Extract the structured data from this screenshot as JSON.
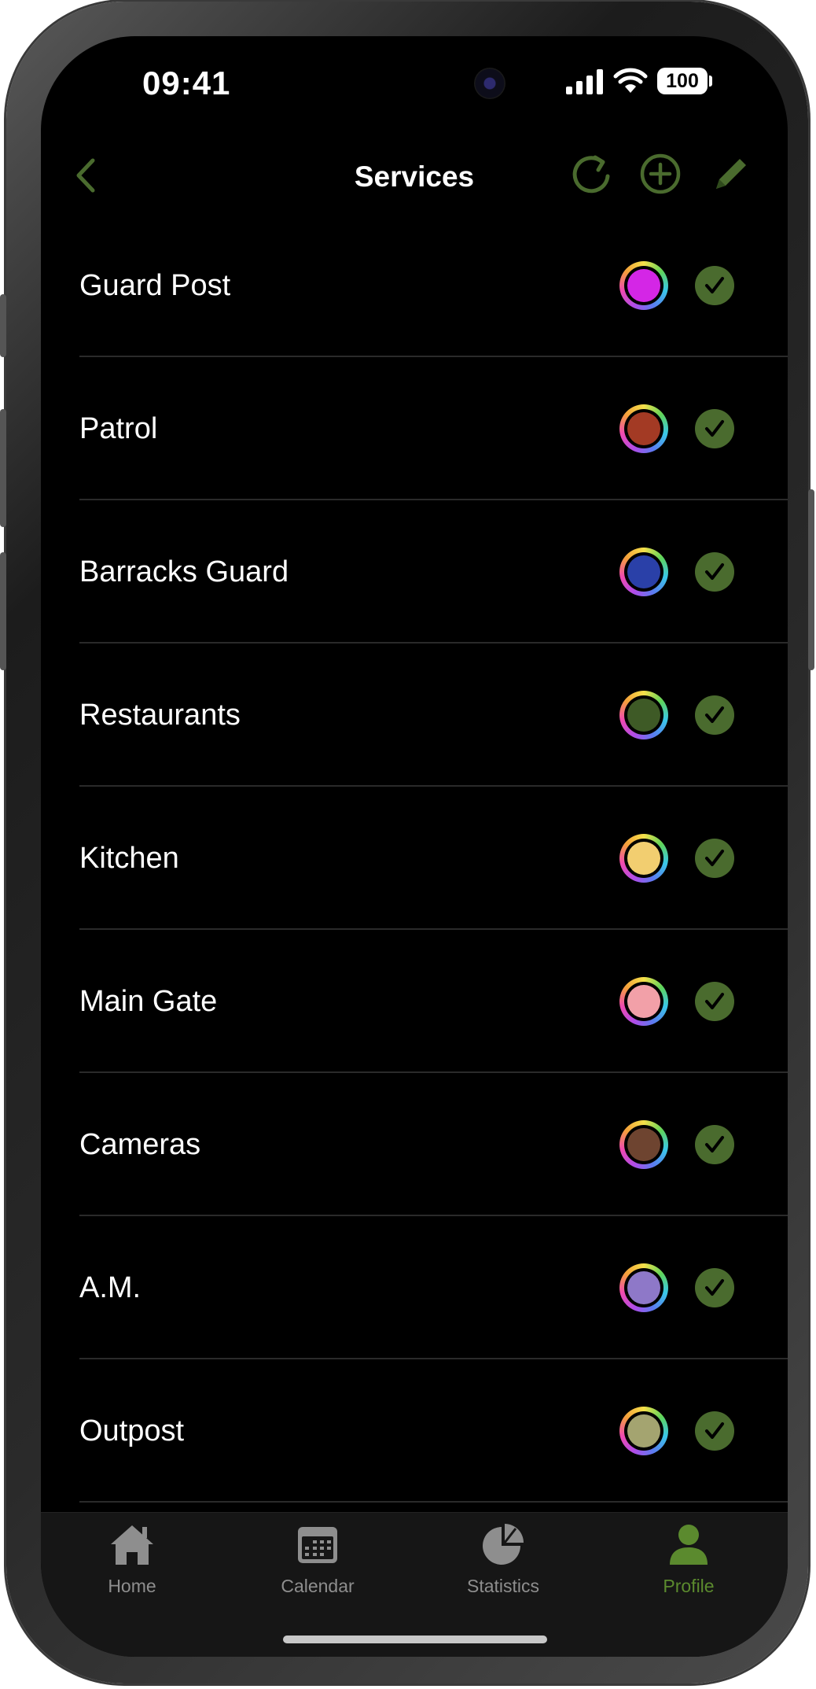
{
  "status_bar": {
    "time": "09:41",
    "battery": "100"
  },
  "nav": {
    "title": "Services"
  },
  "colors": {
    "accent": "#4a6b2e",
    "check_bg": "#4a6b2e",
    "active_tab": "#5b8a2e"
  },
  "services": [
    {
      "name": "Guard Post",
      "color": "#d426e6"
    },
    {
      "name": "Patrol",
      "color": "#a33a24"
    },
    {
      "name": "Barracks Guard",
      "color": "#2a40a8"
    },
    {
      "name": "Restaurants",
      "color": "#3e5a26"
    },
    {
      "name": "Kitchen",
      "color": "#f2ce70"
    },
    {
      "name": "Main Gate",
      "color": "#f2a0a8"
    },
    {
      "name": "Cameras",
      "color": "#6e4430"
    },
    {
      "name": "A.M.",
      "color": "#8e78c8"
    },
    {
      "name": "Outpost",
      "color": "#a4a470"
    }
  ],
  "tab_bar": {
    "tabs": [
      {
        "label": "Home",
        "icon": "house-icon"
      },
      {
        "label": "Calendar",
        "icon": "calendar-icon"
      },
      {
        "label": "Statistics",
        "icon": "pie-chart-icon"
      },
      {
        "label": "Profile",
        "icon": "person-icon"
      }
    ],
    "active": "Profile"
  }
}
